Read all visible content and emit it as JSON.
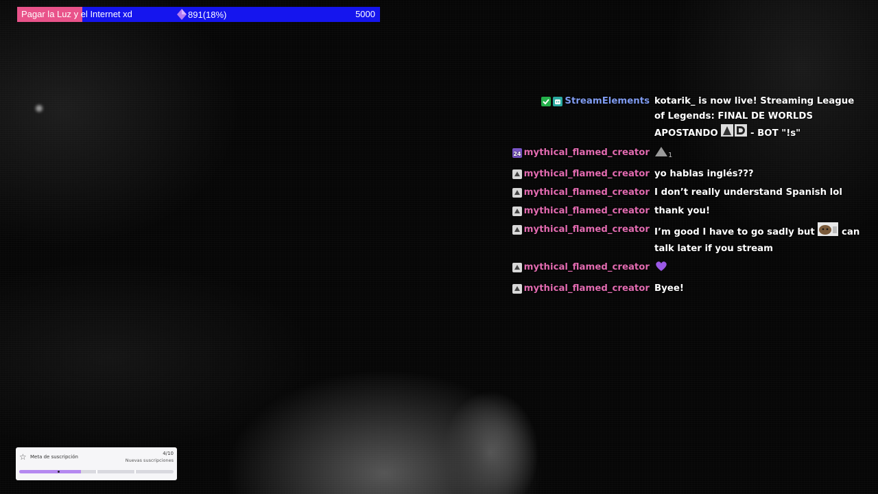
{
  "goal_bar": {
    "title": "Pagar la Luz y el Internet xd",
    "current": "891(18%)",
    "target": "5000",
    "progress_fraction": 0.18,
    "fill_color": "#e9538a",
    "bar_color": "#1515ee"
  },
  "chat": {
    "messages": [
      {
        "badges": [
          "verified-badge",
          "bot-badge"
        ],
        "username": "StreamElements",
        "username_color": "#7f9bf0",
        "text": "kotarik_ is now live! Streaming League of Legends: FINAL DE WORLDS APOSTANDO",
        "emote": "AD-emote",
        "text_after": " - BOT \"!s\""
      },
      {
        "badges": [
          "sub-24-badge"
        ],
        "username": "mythical_flamed_creator",
        "username_color": "#e26bb0",
        "text": "",
        "emote": "triangle-emote",
        "text_after": "1"
      },
      {
        "badges": [
          "viewer-badge"
        ],
        "username": "mythical_flamed_creator",
        "username_color": "#e26bb0",
        "text": "yo hablas inglés???"
      },
      {
        "badges": [
          "viewer-badge"
        ],
        "username": "mythical_flamed_creator",
        "username_color": "#e26bb0",
        "text": "I don’t really understand Spanish lol"
      },
      {
        "badges": [
          "viewer-badge"
        ],
        "username": "mythical_flamed_creator",
        "username_color": "#e26bb0",
        "text": "thank you!"
      },
      {
        "badges": [
          "viewer-badge"
        ],
        "username": "mythical_flamed_creator",
        "username_color": "#e26bb0",
        "text": "I’m good I have to go sadly but",
        "emote": "cat-emote",
        "text_after": " can talk later if you stream"
      },
      {
        "badges": [
          "viewer-badge"
        ],
        "username": "mythical_flamed_creator",
        "username_color": "#e26bb0",
        "text": "",
        "emote": "purple-heart-emote"
      },
      {
        "badges": [
          "viewer-badge"
        ],
        "username": "mythical_flamed_creator",
        "username_color": "#e26bb0",
        "text": "Byee!"
      }
    ]
  },
  "sub_goal": {
    "title": "Meta de suscripción",
    "count": "4/10",
    "label": "Nuevas suscripciones",
    "progress_fraction": 0.4,
    "fill_color": "#b589f0"
  }
}
